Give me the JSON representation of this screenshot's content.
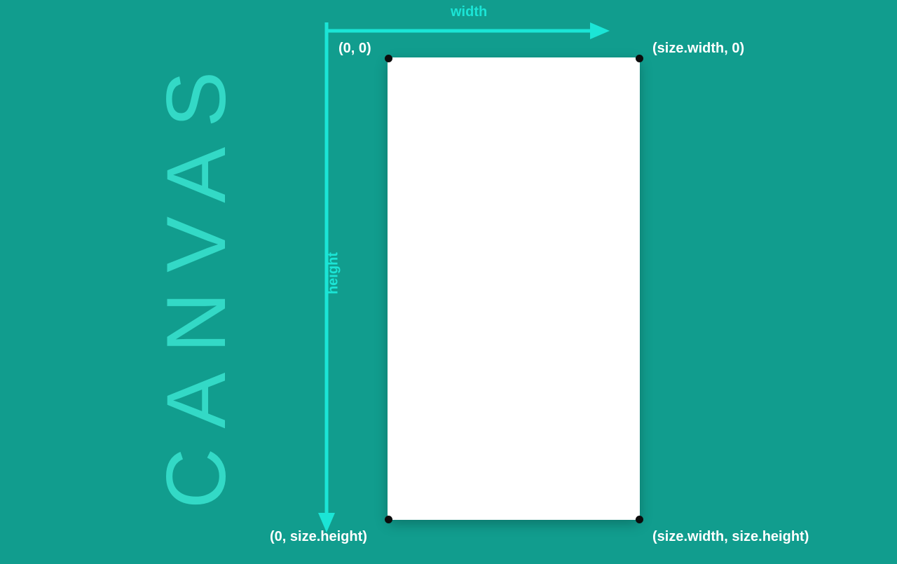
{
  "title": "CANVAS",
  "axis": {
    "width_label": "width",
    "height_label": "height"
  },
  "corners": {
    "top_left": "(0, 0)",
    "top_right": "(size.width, 0)",
    "bottom_left": "(0, size.height)",
    "bottom_right": "(size.width, size.height)"
  },
  "colors": {
    "background": "#119D8E",
    "accent": "#1BE5D6",
    "title_text": "#33D9C6",
    "canvas_fill": "#FFFFFF",
    "label_text": "#FFFFFF",
    "dot": "#0C0C0C"
  }
}
